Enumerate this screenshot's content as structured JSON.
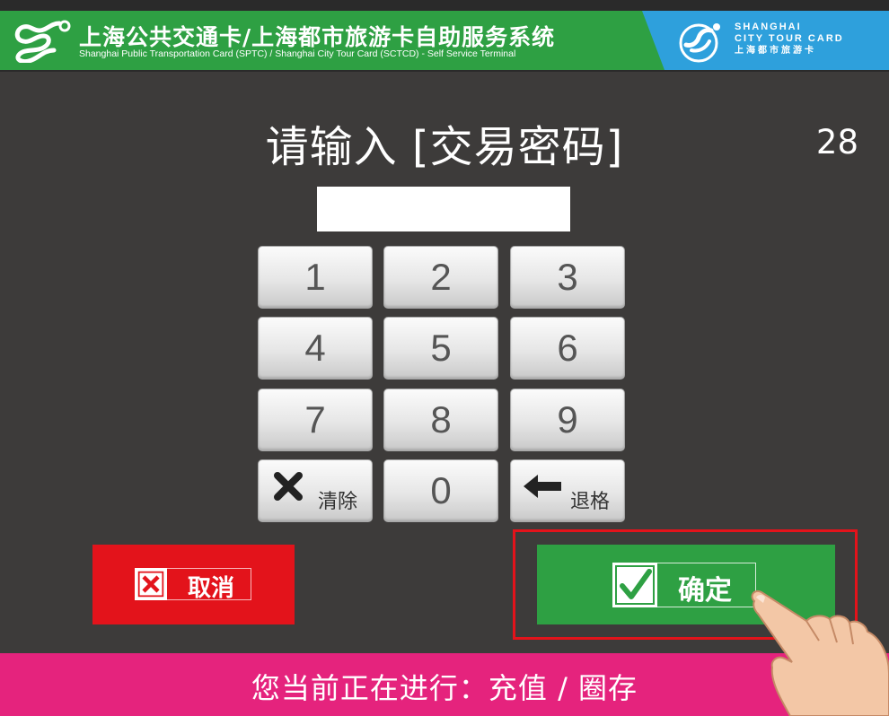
{
  "header": {
    "title_cn": "上海公共交通卡/上海都市旅游卡自助服务系统",
    "title_en": "Shanghai Public Transportation Card (SPTC) / Shanghai City Tour Card (SCTCD) - Self Service Terminal",
    "brand_line1": "SHANGHAI",
    "brand_line2": "CITY TOUR CARD",
    "brand_line3": "上海都市旅游卡",
    "logo_left_icon": "sptc-logo-icon",
    "logo_right_icon": "city-tour-card-logo-icon"
  },
  "prompt": {
    "text": "请输入 [交易密码]",
    "countdown": "28"
  },
  "password_field": {
    "value": ""
  },
  "keypad": {
    "keys": [
      "1",
      "2",
      "3",
      "4",
      "5",
      "6",
      "7",
      "8",
      "9"
    ],
    "clear_label": "清除",
    "zero": "0",
    "backspace_label": "退格",
    "clear_icon": "close-icon",
    "backspace_icon": "arrow-left-icon"
  },
  "actions": {
    "cancel_label": "取消",
    "cancel_icon": "close-box-icon",
    "confirm_label": "确定",
    "confirm_icon": "check-box-icon"
  },
  "footer": {
    "text": "您当前正在进行：充值 / 圈存"
  },
  "colors": {
    "green": "#2ea043",
    "blue": "#2ea0dc",
    "red": "#e3131b",
    "pink": "#e5237d",
    "background": "#3d3b3a"
  }
}
